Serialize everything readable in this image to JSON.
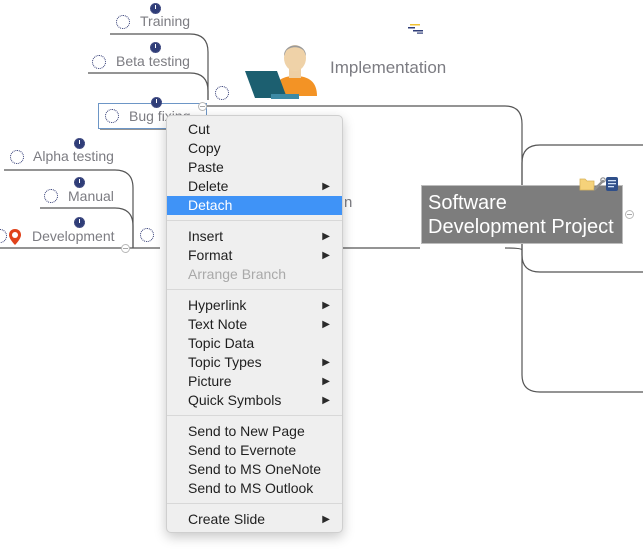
{
  "mindmap": {
    "central_topic": {
      "line1": "Software",
      "line2": "Development Project",
      "fill_color": "#7d7d7d"
    },
    "branches": {
      "implementation": {
        "label": "Implementation"
      },
      "hidden_topic_fragment": "n"
    },
    "subtopics": [
      {
        "label": "Training",
        "icon": "clock-icon",
        "badge": "clock-solid-icon"
      },
      {
        "label": "Beta testing",
        "icon": "clock-icon",
        "badge": "clock-solid-icon"
      },
      {
        "label": "Bug fixing",
        "icon": "clock-icon",
        "badge": "clock-solid-icon",
        "selected": true
      },
      {
        "label": "Alpha testing",
        "icon": "clock-icon",
        "badge": "clock-solid-icon"
      },
      {
        "label": "Manual",
        "icon": "clock-icon",
        "badge": "clock-solid-icon"
      },
      {
        "label": "Development",
        "icon": "clock-icon",
        "badge": "clock-solid-icon",
        "extra_icon": "map-pin-icon"
      }
    ],
    "central_icons": [
      "folder-icon",
      "link-icon",
      "note-icon"
    ],
    "accent_colors": {
      "selection": "#3f93f7",
      "clock": "#2f3d78",
      "pin": "#e0421b"
    }
  },
  "context_menu": {
    "groups": [
      [
        {
          "label": "Cut",
          "submenu": false
        },
        {
          "label": "Copy",
          "submenu": false
        },
        {
          "label": "Paste",
          "submenu": false
        },
        {
          "label": "Delete",
          "submenu": true
        },
        {
          "label": "Detach",
          "submenu": false,
          "highlighted": true
        }
      ],
      [
        {
          "label": "Insert",
          "submenu": true
        },
        {
          "label": "Format",
          "submenu": true
        },
        {
          "label": "Arrange Branch",
          "submenu": false,
          "disabled": true
        }
      ],
      [
        {
          "label": "Hyperlink",
          "submenu": true
        },
        {
          "label": "Text Note",
          "submenu": true
        },
        {
          "label": "Topic Data",
          "submenu": false
        },
        {
          "label": "Topic Types",
          "submenu": true
        },
        {
          "label": "Picture",
          "submenu": true
        },
        {
          "label": "Quick Symbols",
          "submenu": true
        }
      ],
      [
        {
          "label": "Send to New Page",
          "submenu": false
        },
        {
          "label": "Send to Evernote",
          "submenu": false
        },
        {
          "label": "Send to MS OneNote",
          "submenu": false
        },
        {
          "label": "Send to MS Outlook",
          "submenu": false
        }
      ],
      [
        {
          "label": "Create Slide",
          "submenu": true
        }
      ]
    ],
    "arrow_glyph": "▶"
  }
}
